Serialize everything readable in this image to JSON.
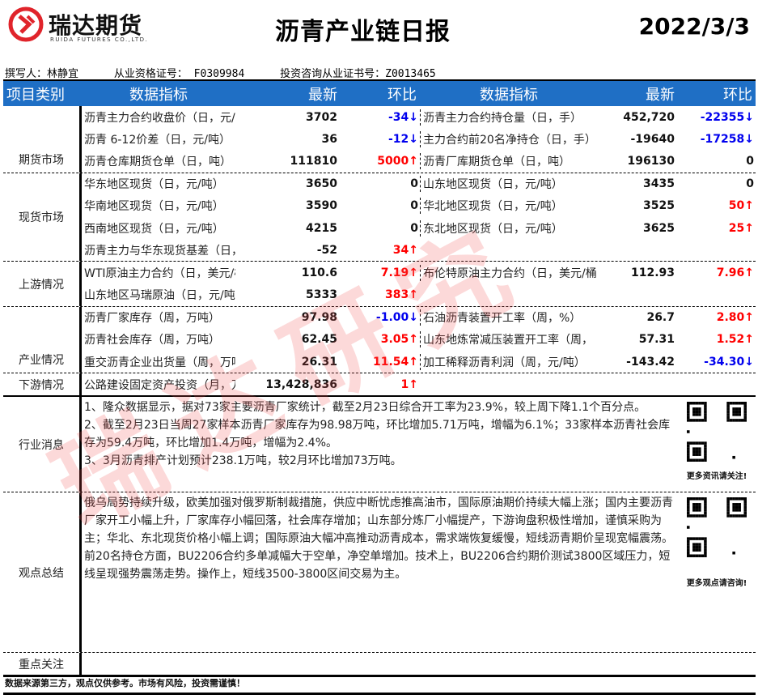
{
  "brand": {
    "name_cn": "瑞达期货",
    "name_en": "RUIDA FUTURES CO.,LTD.",
    "color": "#e0242b"
  },
  "title": "沥青产业链日报",
  "date": "2022/3/3",
  "authors": {
    "writer": "撰写人：林静宜",
    "qual": "从业资格证号： F0309984",
    "invest": "投资咨询从业证书号：Z0013465"
  },
  "header": {
    "category": "项目类别",
    "metric": "数据指标",
    "latest": "最新",
    "change": "环比",
    "metric2": "数据指标",
    "latest2": "最新",
    "change2": "环比",
    "bg": "#1f6fc5"
  },
  "sections": [
    {
      "category": "期货市场",
      "rows": [
        {
          "l": {
            "label": "沥青主力合约收盘价（日，元/吨）",
            "value": "3702",
            "change": "-34↓",
            "dir": "down"
          },
          "r": {
            "label": "沥青主力合约持仓量（日，手）",
            "value": "452,720",
            "change": "-22355↓",
            "dir": "down"
          }
        },
        {
          "l": {
            "label": "沥青 6-12价差（日，元/吨）",
            "value": "36",
            "change": "-12↓",
            "dir": "down"
          },
          "r": {
            "label": "主力合约前20名净持仓（日，手）",
            "value": "-19640",
            "change": "-17258↓",
            "dir": "down"
          }
        },
        {
          "l": {
            "label": "沥青仓库期货仓单（日，吨）",
            "value": "111810",
            "change": "5000↑",
            "dir": "up"
          },
          "r": {
            "label": "沥青厂库期货仓单（日，吨）",
            "value": "196130",
            "change": "0",
            "dir": "flat"
          }
        }
      ]
    },
    {
      "category": "现货市场",
      "rows": [
        {
          "l": {
            "label": "华东地区现货（日，元/吨）",
            "value": "3650",
            "change": "0",
            "dir": "flat"
          },
          "r": {
            "label": "山东地区现货（日，元/吨）",
            "value": "3435",
            "change": "0",
            "dir": "flat"
          }
        },
        {
          "l": {
            "label": "华南地区现货（日，元/吨）",
            "value": "3590",
            "change": "0",
            "dir": "flat"
          },
          "r": {
            "label": "华北地区现货（日，元/吨）",
            "value": "3525",
            "change": "50↑",
            "dir": "up"
          }
        },
        {
          "l": {
            "label": "西南地区现货（日，元/吨）",
            "value": "4215",
            "change": "0",
            "dir": "flat"
          },
          "r": {
            "label": "东北地区现货（日，元/吨）",
            "value": "3625",
            "change": "25↑",
            "dir": "up"
          }
        },
        {
          "l": {
            "label": "沥青主力与华东现货基差（日，元",
            "value": "-52",
            "change": "34↑",
            "dir": "up"
          },
          "r": null
        }
      ]
    },
    {
      "category": "上游情况",
      "rows": [
        {
          "l": {
            "label": "WTI原油主力合约（日，美元/桶）",
            "value": "110.6",
            "change": "7.19↑",
            "dir": "up"
          },
          "r": {
            "label": "布伦特原油主力合约（日，美元/桶",
            "value": "112.93",
            "change": "7.96↑",
            "dir": "up"
          }
        },
        {
          "l": {
            "label": "山东地区马瑞原油（日，元/吨）",
            "value": "5333",
            "change": "383↑",
            "dir": "up"
          },
          "r": null
        }
      ]
    },
    {
      "category": "产业情况",
      "rows": [
        {
          "l": {
            "label": "沥青厂家库存（周，万吨）",
            "value": "97.98",
            "change": "-1.00↓",
            "dir": "down"
          },
          "r": {
            "label": "石油沥青装置开工率（周，%）",
            "value": "26.7",
            "change": "2.80↑",
            "dir": "up"
          }
        },
        {
          "l": {
            "label": "沥青社会库存（周，万吨）",
            "value": "62.45",
            "change": "3.05↑",
            "dir": "up"
          },
          "r": {
            "label": "山东地炼常减压装置开工率（周，",
            "value": "57.31",
            "change": "1.52↑",
            "dir": "up"
          }
        },
        {
          "l": {
            "label": "重交沥青企业出货量（周，万吨）",
            "value": "26.31",
            "change": "11.54↑",
            "dir": "up"
          },
          "r": {
            "label": "加工稀释沥青利润（周，元/吨）",
            "value": "-143.42",
            "change": "-34.30↓",
            "dir": "down"
          }
        }
      ]
    },
    {
      "category": "下游情况",
      "rows": [
        {
          "l": {
            "label": "公路建设固定资产投资（月，万元",
            "value": "13,428,836",
            "change": "1↑",
            "dir": "up"
          },
          "r": null
        }
      ]
    }
  ],
  "news": {
    "category": "行业消息",
    "lines": [
      "1、隆众数据显示，据对73家主要沥青厂家统计，截至2月23日综合开工率为23.9%，较上周下降1.1个百分点。",
      "2、截至2月23日当周27家样本沥青厂家库存为98.98万吨，环比增加5.71万吨，增幅为6.1%；33家样本沥青社会库存为59.4万吨，环比增加1.4万吨，增幅为2.4%。",
      "3、3月沥青排产计划预计238.1万吨，较2月环比增加73万吨。"
    ],
    "qr_caption": "更多资讯请关注!"
  },
  "views": {
    "category": "观点总结",
    "text": "俄乌局势持续升级，欧美加强对俄罗斯制裁措施，供应中断忧虑推高油市，国际原油期价持续大幅上涨；国内主要沥青厂家开工小幅上升，厂家库存小幅回落，社会库存增加；山东部分炼厂小幅提产，下游询盘积极性增加，谨慎采购为主；华北、东北现货价格小幅上调；国际原油大幅冲高推动沥青成本，需求端恢复缓慢，短线沥青期价呈现宽幅震荡。前20名持仓方面，BU2206合约多单减幅大于空单，净空单增加。技术上，BU2206合约期价测试3800区域压力，短线呈现强势震荡走势。操作上，短线3500-3800区间交易为主。",
    "qr_caption": "更多观点请咨询!"
  },
  "focus": {
    "category": "重点关注",
    "text": ""
  },
  "footer": "数据来源第三方，观点仅供参考。市场有风险，投资需谨慎！",
  "watermark": "瑞达研究",
  "colors": {
    "up": "#ff0000",
    "down": "#0000ee"
  }
}
